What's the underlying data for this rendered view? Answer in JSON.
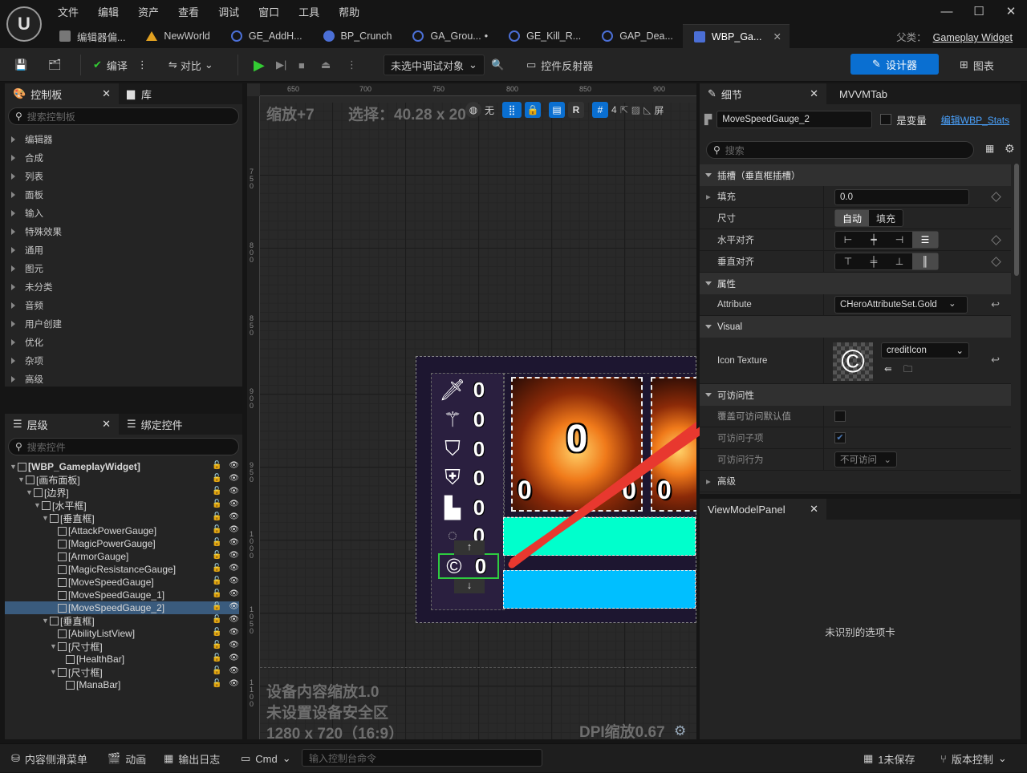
{
  "app": {
    "logo": "U"
  },
  "menu": [
    "文件",
    "编辑",
    "资产",
    "查看",
    "调试",
    "窗口",
    "工具",
    "帮助"
  ],
  "window_controls": [
    "—",
    "☐",
    "✕"
  ],
  "tabs": [
    {
      "label": "编辑器偏...",
      "color": "#888"
    },
    {
      "label": "NewWorld",
      "color": "#e0a020"
    },
    {
      "label": "GE_AddH...",
      "color": "#4b6fd6"
    },
    {
      "label": "BP_Crunch",
      "color": "#4b6fd6"
    },
    {
      "label": "GA_Grou...",
      "color": "#4b6fd6",
      "dot": "•"
    },
    {
      "label": "GE_Kill_R...",
      "color": "#4b6fd6"
    },
    {
      "label": "GAP_Dea...",
      "color": "#4b6fd6"
    },
    {
      "label": "WBP_Ga...",
      "color": "#4b6fd6",
      "active": true,
      "close": "✕"
    }
  ],
  "parent": {
    "label": "父类：",
    "value": "Gameplay Widget"
  },
  "toolbar": {
    "compile": "编译",
    "diff": "对比",
    "debug_target": "未选中调试对象",
    "reflector": "控件反射器",
    "design": "设计器",
    "graph": "图表"
  },
  "palette": {
    "tab": "控制板",
    "library_tab": "库",
    "search_placeholder": "搜索控制板",
    "categories": [
      "编辑器",
      "合成",
      "列表",
      "面板",
      "输入",
      "特殊效果",
      "通用",
      "图元",
      "未分类",
      "音频",
      "用户创建",
      "优化",
      "杂项",
      "高级"
    ]
  },
  "hierarchy": {
    "tab": "层级",
    "bind_tab": "绑定控件",
    "search_placeholder": "搜索控件",
    "items": [
      {
        "label": "[WBP_GameplayWidget]",
        "depth": 0,
        "bold": true
      },
      {
        "label": "[画布面板]",
        "depth": 1
      },
      {
        "label": "[边界]",
        "depth": 2
      },
      {
        "label": "[水平框]",
        "depth": 3
      },
      {
        "label": "[垂直框]",
        "depth": 4
      },
      {
        "label": "[AttackPowerGauge]",
        "depth": 5
      },
      {
        "label": "[MagicPowerGauge]",
        "depth": 5
      },
      {
        "label": "[ArmorGauge]",
        "depth": 5
      },
      {
        "label": "[MagicResistanceGauge]",
        "depth": 5
      },
      {
        "label": "[MoveSpeedGauge]",
        "depth": 5
      },
      {
        "label": "[MoveSpeedGauge_1]",
        "depth": 5
      },
      {
        "label": "[MoveSpeedGauge_2]",
        "depth": 5,
        "selected": true
      },
      {
        "label": "[垂直框]",
        "depth": 4
      },
      {
        "label": "[AbilityListView]",
        "depth": 5
      },
      {
        "label": "[尺寸框]",
        "depth": 5
      },
      {
        "label": "[HealthBar]",
        "depth": 6
      },
      {
        "label": "[尺寸框]",
        "depth": 5
      },
      {
        "label": "[ManaBar]",
        "depth": 6
      }
    ]
  },
  "canvas": {
    "zoom": "缩放+7",
    "selection": "选择：40.28 x 20",
    "none_label": "无",
    "r_label": "R",
    "grid_count": "4",
    "screen_label": "屏",
    "ruler_top": [
      "650",
      "700",
      "750",
      "800",
      "850",
      "900"
    ],
    "ruler_left": [
      "7\n5\n0",
      "8\n0\n0",
      "8\n5\n0",
      "9\n0\n0",
      "9\n5\n0",
      "1\n0\n0\n0",
      "1\n0\n5\n0",
      "1\n1\n0\n0"
    ],
    "device_scale": "设备内容缩放1.0",
    "safe_zone": "未设置设备安全区",
    "resolution": "1280 x 720（16:9）",
    "dpi": "DPI缩放0.67",
    "stats": [
      "0",
      "0",
      "0",
      "0",
      "0",
      "0",
      "0"
    ],
    "card1_big": "0",
    "card1_left": "0",
    "card1_right": "0",
    "card2_left": "0",
    "health_color": "#00ffcc",
    "mana_color": "#00bfff"
  },
  "details": {
    "tab": "细节",
    "mvvm_tab": "MVVMTab",
    "widget_name": "MoveSpeedGauge_2",
    "is_variable": "是变量",
    "edit_link": "编辑WBP_Stats",
    "search_placeholder": "搜索",
    "slot_section": "插槽（垂直框插槽）",
    "padding_label": "填充",
    "padding_value": "0.0",
    "size_label": "尺寸",
    "size_auto": "自动",
    "size_fill": "填充",
    "halign_label": "水平对齐",
    "valign_label": "垂直对齐",
    "props_section": "属性",
    "attribute_label": "Attribute",
    "attribute_value": "CHeroAttributeSet.Gold",
    "visual_section": "Visual",
    "icon_texture_label": "Icon Texture",
    "icon_texture_value": "creditIcon",
    "access_section": "可访问性",
    "access_default": "覆盖可访问默认值",
    "access_children": "可访问子项",
    "access_behavior": "可访问行为",
    "access_behavior_value": "不可访问",
    "advanced_section": "高级"
  },
  "viewmodel": {
    "tab": "ViewModelPanel",
    "message": "未识别的选项卡"
  },
  "status": {
    "content_drawer": "内容侧滑菜单",
    "animation": "动画",
    "output_log": "输出日志",
    "cmd": "Cmd",
    "console_placeholder": "输入控制台命令",
    "unsaved": "1未保存",
    "source_control": "版本控制"
  }
}
